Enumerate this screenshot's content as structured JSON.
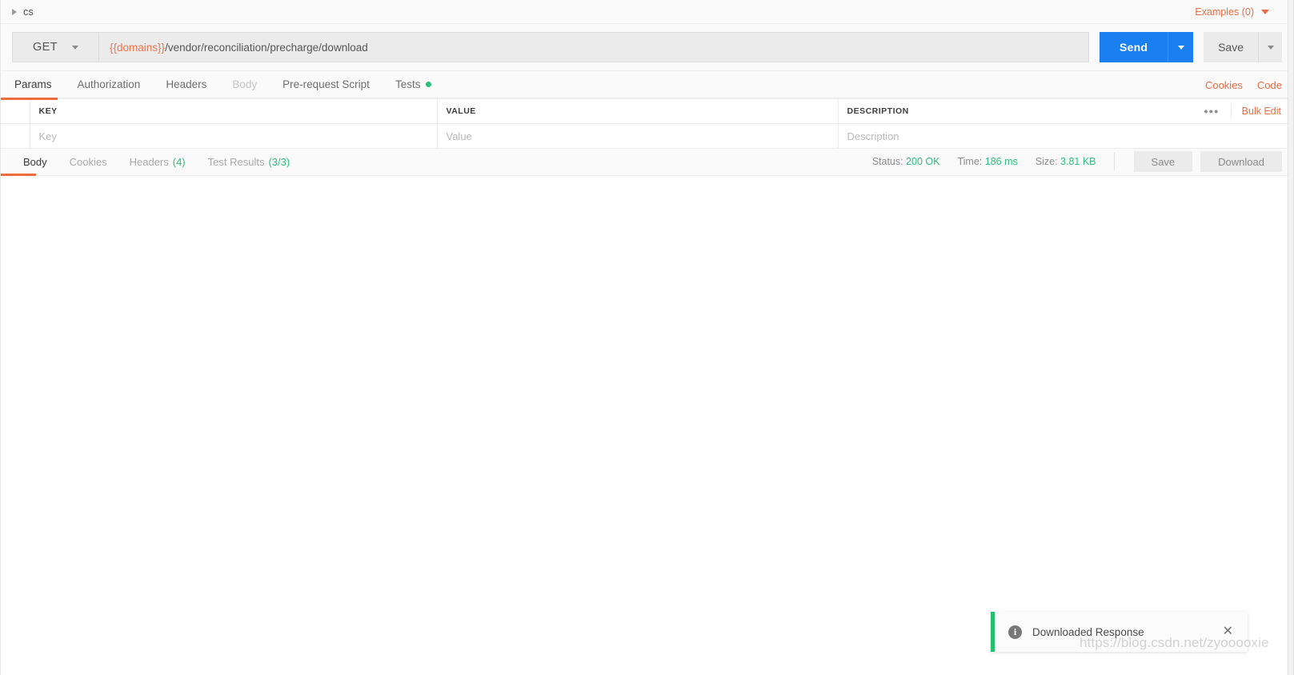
{
  "breadcrumb": {
    "caret_icon": "triangle-right-icon",
    "label": "cs",
    "examples_label": "Examples (0)",
    "examples_caret_icon": "chevron-down-icon"
  },
  "request": {
    "method": "GET",
    "method_caret_icon": "chevron-down-icon",
    "url_variable": "{{domains}}",
    "url_path": "/vendor/reconciliation/precharge/download",
    "url_full": "{{domains}}/vendor/reconciliation/precharge/download",
    "send_label": "Send",
    "send_caret_icon": "chevron-down-icon",
    "save_label": "Save",
    "save_caret_icon": "chevron-down-icon"
  },
  "request_tabs": {
    "items": [
      {
        "label": "Params",
        "state": "active"
      },
      {
        "label": "Authorization",
        "state": "strong"
      },
      {
        "label": "Headers",
        "state": "strong"
      },
      {
        "label": "Body",
        "state": "dim"
      },
      {
        "label": "Pre-request Script",
        "state": "strong"
      },
      {
        "label": "Tests",
        "state": "strong",
        "dot": "green"
      }
    ],
    "right_links": [
      "Cookies",
      "Code"
    ]
  },
  "params_table": {
    "headers": [
      "KEY",
      "VALUE",
      "DESCRIPTION"
    ],
    "placeholders": [
      "Key",
      "Value",
      "Description"
    ],
    "ellipsis_icon": "more-options-icon",
    "ellipsis_glyph": "•••",
    "bulk_edit_label": "Bulk Edit",
    "rows": []
  },
  "response": {
    "tabs": [
      {
        "label": "Body",
        "count": "",
        "state": "active"
      },
      {
        "label": "Cookies",
        "count": "",
        "state": "idle"
      },
      {
        "label": "Headers",
        "count": "(4)",
        "state": "idle"
      },
      {
        "label": "Test Results",
        "count": "(3/3)",
        "state": "idle"
      }
    ],
    "meta": {
      "status_label": "Status:",
      "status_value": "200 OK",
      "time_label": "Time:",
      "time_value": "186 ms",
      "size_label": "Size:",
      "size_value": "3.81 KB"
    },
    "save_label": "Save",
    "download_label": "Download",
    "body_content": ""
  },
  "toast": {
    "icon": "info-icon",
    "icon_glyph": "i",
    "message": "Downloaded Response",
    "close_icon": "close-icon",
    "close_glyph": "✕",
    "accent_color": "#25bf6d"
  },
  "watermark": {
    "text": "https://blog.csdn.net/zyooooxie"
  },
  "colors": {
    "accent_orange": "#eb6c43",
    "send_blue": "#1a7ff1",
    "success_green": "#2dbd7e",
    "toast_green": "#25bf6d"
  }
}
